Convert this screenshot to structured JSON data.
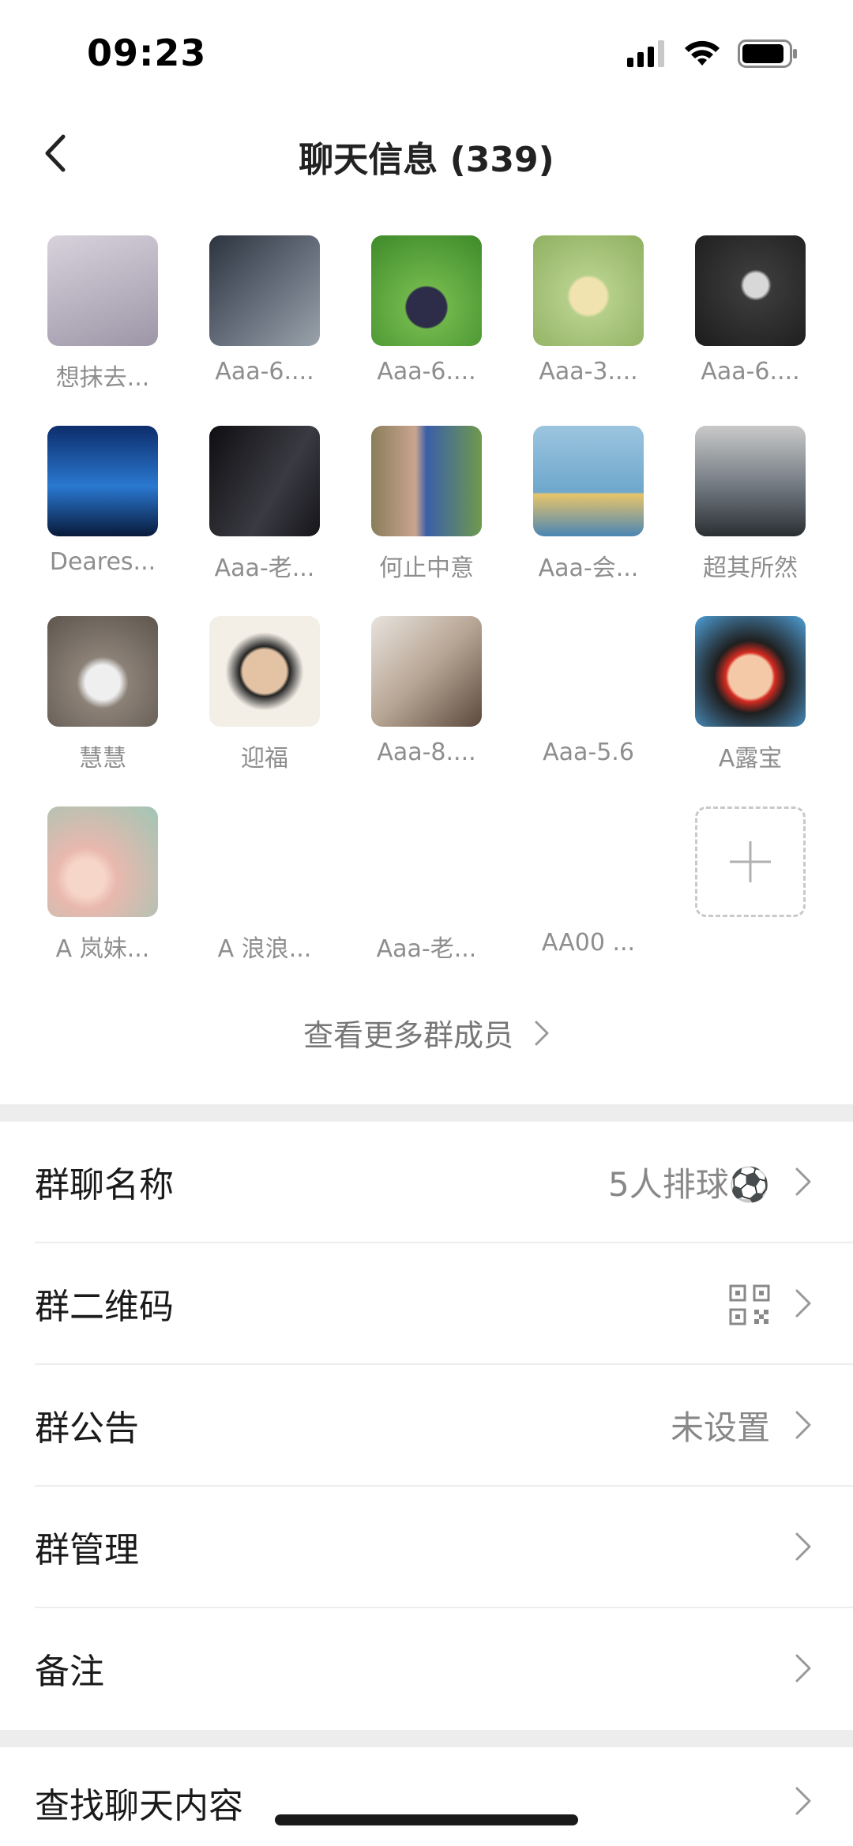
{
  "status": {
    "time": "09:23"
  },
  "header": {
    "title": "聊天信息 (339)"
  },
  "members": [
    {
      "name": "想抹去...",
      "color": "#b9b2c3"
    },
    {
      "name": "Aaa-6....",
      "color": "#3e4650"
    },
    {
      "name": "Aaa-6....",
      "color": "#5aa03a"
    },
    {
      "name": "Aaa-3....",
      "color": "#a7c27d"
    },
    {
      "name": "Aaa-6....",
      "color": "#2b2b2b"
    },
    {
      "name": "Deares...",
      "color": "#1d4f9c"
    },
    {
      "name": "Aaa-老...",
      "color": "#1e1e22"
    },
    {
      "name": "何止中意",
      "color": "#6b8f4f"
    },
    {
      "name": "Aaa-会...",
      "color": "#7fb2d3"
    },
    {
      "name": "超其所然",
      "color": "#4e555d"
    },
    {
      "name": "慧慧",
      "color": "#8f857a"
    },
    {
      "name": "迎福",
      "color": "#d9c8b4"
    },
    {
      "name": "Aaa-8....",
      "color": "#c7b7a6"
    },
    {
      "name": "Aaa-5.6",
      "color": ""
    },
    {
      "name": "A露宝",
      "color": "#d43a2d"
    },
    {
      "name": "A 岚妹...",
      "color": "#e8b8b0"
    },
    {
      "name": "A 浪浪...",
      "color": ""
    },
    {
      "name": "Aaa-老...",
      "color": ""
    },
    {
      "name": "AA00 ...",
      "color": ""
    }
  ],
  "more_members": "查看更多群成员",
  "settings": {
    "group_name": {
      "label": "群聊名称",
      "value": "5人排球⚽"
    },
    "qr_code": {
      "label": "群二维码"
    },
    "announcement": {
      "label": "群公告",
      "value": "未设置"
    },
    "manage": {
      "label": "群管理"
    },
    "remark": {
      "label": "备注"
    },
    "search_chat": {
      "label": "查找聊天内容"
    }
  },
  "icons": {
    "back": "chevron-left-icon",
    "chevron": "chevron-right-icon",
    "add": "plus-icon",
    "qr": "qr-code-icon"
  }
}
